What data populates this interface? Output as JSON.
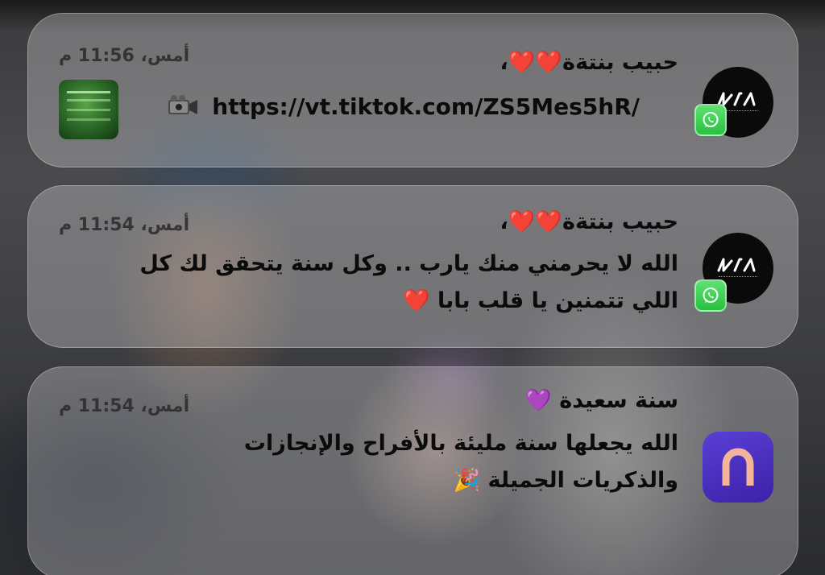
{
  "notifications": [
    {
      "title": "حبيب بنتةة❤️❤️،",
      "time": "أمس، 11:56 م",
      "link": "https://vt.tiktok.com/ZS5Mes5hR/",
      "app": "WhatsApp",
      "sender_icon": "kia-logo-icon",
      "attachment_icon": "video-camera-icon",
      "thumbnail": "video-thumbnail"
    },
    {
      "title": "حبيب بنتةة❤️❤️،",
      "time": "أمس، 11:54 م",
      "body_line1": "الله لا يحرمني منك يارب .. وكل سنة يتحقق لك كل",
      "body_line2": "اللي تتمنين يا قلب بابا ❤️",
      "app": "WhatsApp",
      "sender_icon": "kia-logo-icon"
    },
    {
      "title": "سنة سعيدة 💜",
      "time": "أمس، 11:54 م",
      "body_line1": "الله يجعلها سنة مليئة بالأفراح والإنجازات",
      "body_line2": "والذكريات الجميلة 🎉",
      "app_icon": "n-app-icon"
    }
  ],
  "colors": {
    "whatsapp_green": "#28c13f",
    "heart_red": "#e0242a",
    "app_purple": "#4b2fc4",
    "app_letter": "#f3b59a"
  }
}
